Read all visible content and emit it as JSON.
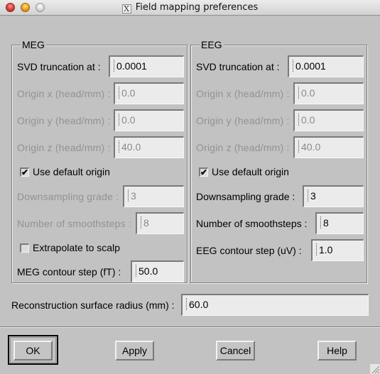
{
  "window": {
    "title": "Field mapping preferences",
    "title_icon": "x11-icon",
    "controls": [
      "close",
      "minimize",
      "zoom"
    ]
  },
  "meg": {
    "legend": "MEG",
    "svd_label": "SVD truncation at :",
    "svd_value": "0.0001",
    "origin_x_label": "Origin x (head/mm) :",
    "origin_x_value": "0.0",
    "origin_y_label": "Origin y (head/mm) :",
    "origin_y_value": "0.0",
    "origin_z_label": "Origin z (head/mm) :",
    "origin_z_value": "40.0",
    "use_default_origin_label": "Use default origin",
    "use_default_origin_checked": true,
    "downsampling_label": "Downsampling grade :",
    "downsampling_value": "3",
    "smoothsteps_label": "Number of smoothsteps :",
    "smoothsteps_value": "8",
    "extrapolate_label": "Extrapolate to scalp",
    "extrapolate_checked": false,
    "contour_label": "MEG contour step (fT) :",
    "contour_value": "50.0"
  },
  "eeg": {
    "legend": "EEG",
    "svd_label": "SVD truncation at :",
    "svd_value": "0.0001",
    "origin_x_label": "Origin x (head/mm) :",
    "origin_x_value": "0.0",
    "origin_y_label": "Origin y (head/mm) :",
    "origin_y_value": "0.0",
    "origin_z_label": "Origin z (head/mm) :",
    "origin_z_value": "40.0",
    "use_default_origin_label": "Use default origin",
    "use_default_origin_checked": true,
    "downsampling_label": "Downsampling grade :",
    "downsampling_value": "3",
    "smoothsteps_label": "Number of smoothsteps :",
    "smoothsteps_value": "8",
    "contour_label": "EEG contour step (uV) :",
    "contour_value": "1.0"
  },
  "reconstruction": {
    "label": "Reconstruction surface radius (mm) :",
    "value": "60.0"
  },
  "buttons": {
    "ok": "OK",
    "apply": "Apply",
    "cancel": "Cancel",
    "help": "Help"
  },
  "glyphs": {
    "check": "✔",
    "x_logo": "X"
  }
}
